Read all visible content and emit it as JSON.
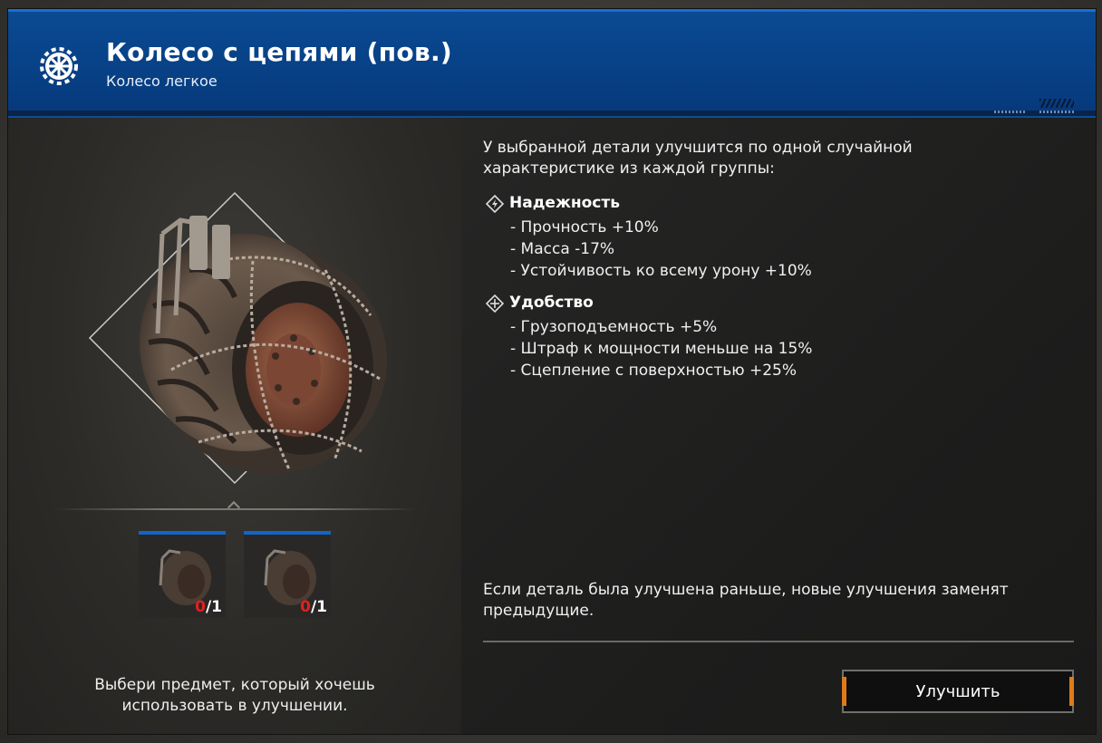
{
  "header": {
    "title": "Колесо с цепями (пов.)",
    "subtitle": "Колесо легкое",
    "icon": "gear-wheel-icon"
  },
  "left": {
    "slots": [
      {
        "have": "0",
        "need": "/1"
      },
      {
        "have": "0",
        "need": "/1"
      }
    ],
    "hint": "Выбери предмет, который хочешь использовать в улучшении."
  },
  "right": {
    "intro": "У выбранной детали улучшится по одной случайной характеристике из каждой группы:",
    "groups": [
      {
        "title": "Надежность",
        "icon": "reliability-icon",
        "stats": [
          "- Прочность +10%",
          "- Масса -17%",
          "- Устойчивость ко всему урону +10%"
        ]
      },
      {
        "title": "Удобство",
        "icon": "convenience-icon",
        "stats": [
          "- Грузоподъемность +5%",
          "- Штраф к мощности меньше на 15%",
          "- Сцепление с поверхностью +25%"
        ]
      }
    ],
    "note": "Если деталь была улучшена раньше, новые улучшения заменят предыдущие.",
    "upgrade_label": "Улучшить"
  },
  "colors": {
    "header_blue": "#06397b",
    "slot_accent": "#1066c6",
    "count_red": "#e41f1f",
    "button_accent": "#e07a1a"
  }
}
